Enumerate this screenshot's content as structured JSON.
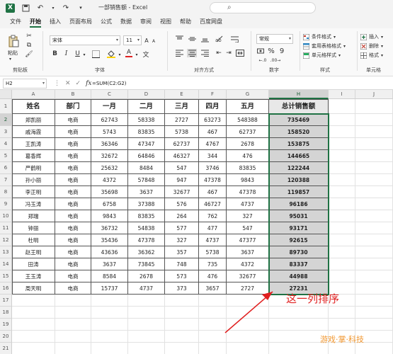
{
  "titlebar": {
    "title": "一部销售额 - Excel"
  },
  "menu": {
    "items": [
      "文件",
      "开始",
      "插入",
      "页面布局",
      "公式",
      "数据",
      "审阅",
      "视图",
      "帮助",
      "百度网盘"
    ],
    "active": "开始"
  },
  "ribbon": {
    "clipboard": {
      "paste_label": "粘贴",
      "group_label": "剪贴板"
    },
    "font": {
      "name": "宋体",
      "size": "11",
      "group_label": "字体",
      "grow": "A",
      "shrink": "A",
      "bold": "B",
      "italic": "I",
      "underline": "U",
      "font_color_glyph": "A"
    },
    "alignment": {
      "group_label": "对齐方式"
    },
    "number": {
      "format": "常规",
      "percent": "%",
      "comma": "9",
      "group_label": "数字"
    },
    "styles": {
      "conditional": "条件格式",
      "table": "套用表格格式",
      "cell": "单元格样式",
      "group_label": "样式"
    },
    "cells": {
      "insert": "插入",
      "delete": "删除",
      "format": "格式",
      "group_label": "单元格"
    }
  },
  "formula_bar": {
    "name_box": "H2",
    "formula": "=SUM(C2:G2)"
  },
  "sheet": {
    "columns": [
      "A",
      "B",
      "C",
      "D",
      "E",
      "F",
      "G",
      "H",
      "I",
      "J"
    ],
    "rows": [
      "1",
      "2",
      "3",
      "4",
      "5",
      "6",
      "7",
      "8",
      "9",
      "10",
      "11",
      "12",
      "13",
      "14",
      "15",
      "16",
      "17",
      "18",
      "19",
      "20",
      "21",
      "22"
    ],
    "header": [
      "姓名",
      "部门",
      "一月",
      "二月",
      "三月",
      "四月",
      "五月",
      "总计销售额"
    ],
    "data": [
      [
        "郑凯丽",
        "电商",
        "62743",
        "58338",
        "2727",
        "63273",
        "548388",
        "735469"
      ],
      [
        "戚海霞",
        "电商",
        "5743",
        "83835",
        "5738",
        "467",
        "62737",
        "158520"
      ],
      [
        "王凯涛",
        "电商",
        "36346",
        "47347",
        "62737",
        "4767",
        "2678",
        "153875"
      ],
      [
        "葛香辉",
        "电商",
        "32672",
        "64846",
        "46327",
        "344",
        "476",
        "144665"
      ],
      [
        "严鹤明",
        "电商",
        "25632",
        "8484",
        "547",
        "3746",
        "83835",
        "122244"
      ],
      [
        "孙小丽",
        "电商",
        "4372",
        "57848",
        "947",
        "47378",
        "9843",
        "120388"
      ],
      [
        "李正明",
        "电商",
        "35698",
        "3637",
        "32677",
        "467",
        "47378",
        "119857"
      ],
      [
        "冯玉涛",
        "电商",
        "6758",
        "37388",
        "576",
        "46727",
        "4737",
        "96186"
      ],
      [
        "郑瑞",
        "电商",
        "9843",
        "83835",
        "264",
        "762",
        "327",
        "95031"
      ],
      [
        "钟丽",
        "电商",
        "36732",
        "54838",
        "577",
        "477",
        "547",
        "93171"
      ],
      [
        "杜明",
        "电商",
        "35436",
        "47378",
        "327",
        "4737",
        "47377",
        "92615"
      ],
      [
        "赵王明",
        "电商",
        "43636",
        "36362",
        "357",
        "5738",
        "3637",
        "89730"
      ],
      [
        "田涛",
        "电商",
        "3637",
        "73845",
        "748",
        "735",
        "4372",
        "83337"
      ],
      [
        "王玉涛",
        "电商",
        "8584",
        "2678",
        "573",
        "476",
        "32677",
        "44988"
      ],
      [
        "周天明",
        "电商",
        "15737",
        "4737",
        "373",
        "3657",
        "2727",
        "27231"
      ]
    ]
  },
  "annotation": {
    "text": "这一列排序",
    "color": "#e02020"
  },
  "watermark": {
    "text": "游戏·掌·科技"
  },
  "colors": {
    "brand": "#1f7244",
    "highlight_column": "#d4d4d4"
  }
}
